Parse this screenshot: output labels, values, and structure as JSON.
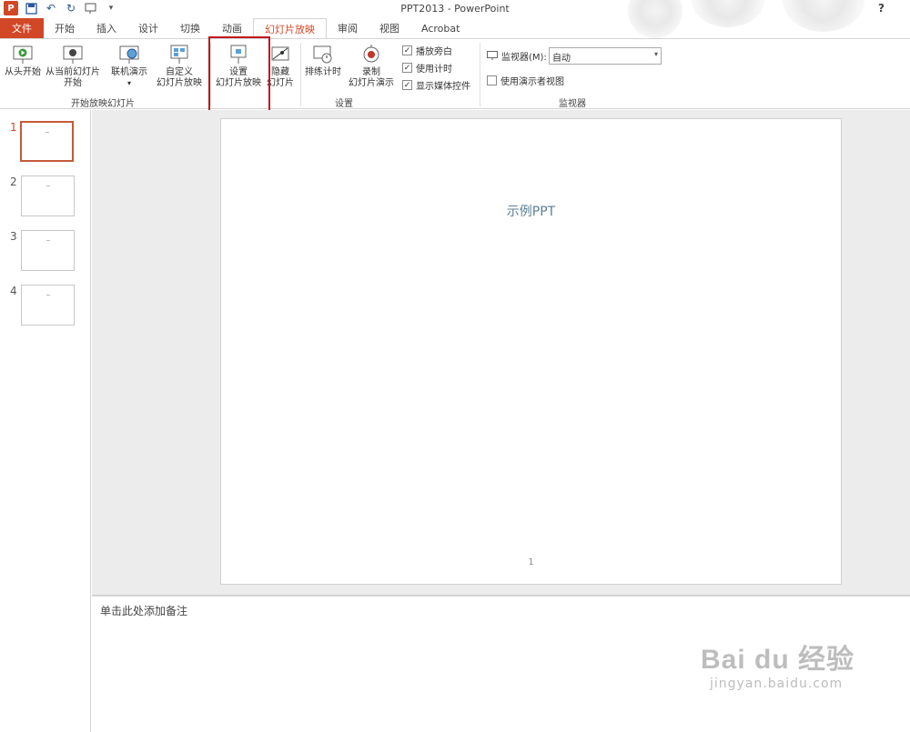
{
  "window": {
    "title": "PPT2013 - PowerPoint",
    "help": "?"
  },
  "quick_access": {
    "logo": "P"
  },
  "tabs": [
    {
      "label": "文件"
    },
    {
      "label": "开始"
    },
    {
      "label": "插入"
    },
    {
      "label": "设计"
    },
    {
      "label": "切换"
    },
    {
      "label": "动画"
    },
    {
      "label": "幻灯片放映"
    },
    {
      "label": "审阅"
    },
    {
      "label": "视图"
    },
    {
      "label": "Acrobat"
    }
  ],
  "ribbon": {
    "group_start": {
      "label": "开始放映幻灯片",
      "from_beginning": "从头开始",
      "from_current_1": "从当前幻灯片",
      "from_current_2": "开始",
      "online_present": "联机演示",
      "custom_show_1": "自定义",
      "custom_show_2": "幻灯片放映"
    },
    "group_setup": {
      "label": "设置",
      "setup_show_1": "设置",
      "setup_show_2": "幻灯片放映",
      "hide_slide_1": "隐藏",
      "hide_slide_2": "幻灯片",
      "rehearse": "排练计时",
      "record_1": "录制",
      "record_2": "幻灯片演示",
      "play_narrations": "播放旁白",
      "use_timings": "使用计时",
      "show_media_controls": "显示媒体控件"
    },
    "group_monitors": {
      "label": "监视器",
      "monitor_label": "监视器(M):",
      "monitor_value": "自动",
      "presenter_view": "使用演示者视图"
    }
  },
  "thumbnails": [
    {
      "number": "1"
    },
    {
      "number": "2"
    },
    {
      "number": "3"
    },
    {
      "number": "4"
    }
  ],
  "slide": {
    "title": "示例PPT",
    "page_number": "1"
  },
  "notes": {
    "placeholder": "单击此处添加备注"
  },
  "watermark": {
    "main": "Bai du 经验",
    "sub": "jingyan.baidu.com"
  },
  "colors": {
    "accent": "#d24726",
    "highlight_box": "#c0171b"
  }
}
